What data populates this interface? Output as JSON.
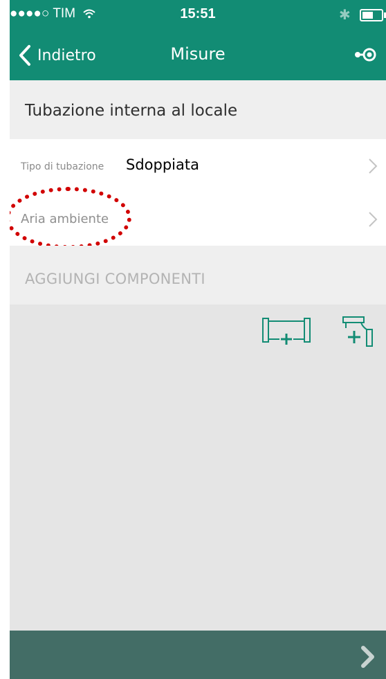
{
  "status_bar": {
    "carrier": "●●●●○ TIM",
    "wifi_icon": "wifi-icon",
    "time": "15:51",
    "bluetooth_icon": "bluetooth-icon",
    "battery_icon": "battery-icon"
  },
  "nav": {
    "back_label": "Indietro",
    "title": "Misure",
    "action_icon": "key-settings-icon"
  },
  "section": {
    "title": "Tubazione interna al locale"
  },
  "rows": [
    {
      "label": "Tipo di tubazione",
      "value": "Sdoppiata"
    },
    {
      "label": "Aria ambiente"
    }
  ],
  "components": {
    "header": "AGGIUNGI COMPONENTI",
    "add_pipe_icon": "add-pipe-icon",
    "add_elbow_icon": "add-elbow-icon"
  },
  "colors": {
    "header_green": "#128c74",
    "bottom_bar": "#436d66",
    "highlight": "#d10000"
  }
}
